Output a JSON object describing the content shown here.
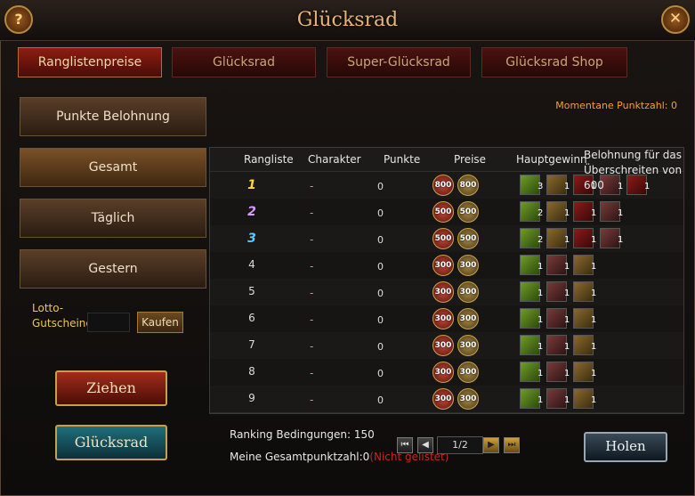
{
  "window": {
    "title": "Glücksrad",
    "help_icon": "question-mark-icon",
    "close_icon": "close-x-icon"
  },
  "tabs": [
    {
      "label": "Ranglistenpreise",
      "active": true
    },
    {
      "label": "Glücksrad",
      "active": false
    },
    {
      "label": "Super-Glücksrad",
      "active": false
    },
    {
      "label": "Glücksrad Shop",
      "active": false
    }
  ],
  "sidebar": {
    "buttons": [
      {
        "label": "Punkte Belohnung"
      },
      {
        "label": "Gesamt"
      },
      {
        "label": "Täglich"
      },
      {
        "label": "Gestern"
      }
    ],
    "lotto_label": "Lotto-\nGutscheine",
    "buy_label": "Kaufen",
    "draw_label": "Ziehen",
    "wheel_label": "Glücksrad"
  },
  "status": {
    "current_points": "Momentane Punktzahl:  0"
  },
  "bonus_text": "Belohnung für das Überschreiten von 600",
  "table": {
    "headers": [
      "Rangliste",
      "Charakter",
      "Punkte",
      "Preise",
      "Hauptgewinn"
    ],
    "rows": [
      {
        "rank": "1",
        "character": "-",
        "points": "0",
        "prize": [
          "800",
          "800"
        ],
        "items": [
          "3",
          "1",
          "1",
          "1",
          "1"
        ]
      },
      {
        "rank": "2",
        "character": "-",
        "points": "0",
        "prize": [
          "500",
          "500"
        ],
        "items": [
          "2",
          "1",
          "1",
          "1"
        ]
      },
      {
        "rank": "3",
        "character": "-",
        "points": "0",
        "prize": [
          "500",
          "500"
        ],
        "items": [
          "2",
          "1",
          "1",
          "1"
        ]
      },
      {
        "rank": "4",
        "character": "-",
        "points": "0",
        "prize": [
          "300",
          "300"
        ],
        "items": [
          "1",
          "1",
          "1"
        ]
      },
      {
        "rank": "5",
        "character": "-",
        "points": "0",
        "prize": [
          "300",
          "300"
        ],
        "items": [
          "1",
          "1",
          "1"
        ]
      },
      {
        "rank": "6",
        "character": "-",
        "points": "0",
        "prize": [
          "300",
          "300"
        ],
        "items": [
          "1",
          "1",
          "1"
        ]
      },
      {
        "rank": "7",
        "character": "-",
        "points": "0",
        "prize": [
          "300",
          "300"
        ],
        "items": [
          "1",
          "1",
          "1"
        ]
      },
      {
        "rank": "8",
        "character": "-",
        "points": "0",
        "prize": [
          "300",
          "300"
        ],
        "items": [
          "1",
          "1",
          "1"
        ]
      },
      {
        "rank": "9",
        "character": "-",
        "points": "0",
        "prize": [
          "300",
          "300"
        ],
        "items": [
          "1",
          "1",
          "1"
        ]
      }
    ]
  },
  "footer": {
    "ranking_conditions": "Ranking Bedingungen: 150",
    "my_total": "Meine Gesamtpunktzahl:0",
    "not_listed": "(Nicht gelistet)",
    "page": "1/2",
    "collect_label": "Holen"
  }
}
